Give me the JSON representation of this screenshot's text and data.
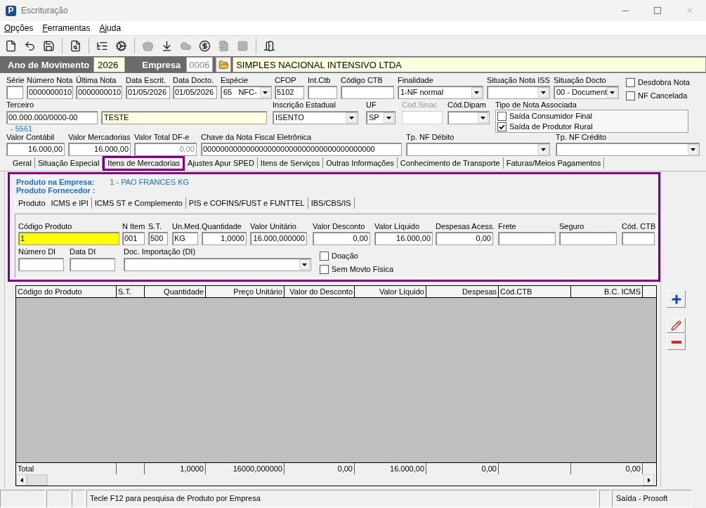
{
  "window": {
    "logo": "P",
    "title": "Escrituração"
  },
  "menu": [
    {
      "label": "Opções"
    },
    {
      "label": "Ferramentas"
    },
    {
      "label": "Ajuda"
    }
  ],
  "toolbar": {
    "groups": [
      [
        {
          "disabled": false
        },
        {
          "disabled": false
        },
        {
          "disabled": false
        }
      ],
      [
        {
          "disabled": false
        }
      ],
      [
        {
          "disabled": false
        },
        {
          "disabled": false
        }
      ],
      [
        {
          "disabled": true
        },
        {
          "disabled": false
        },
        {
          "disabled": true
        },
        {
          "disabled": false
        },
        {
          "disabled": true
        },
        {
          "disabled": true
        }
      ],
      [
        {
          "disabled": false
        }
      ]
    ]
  },
  "header": {
    "year_label": "Ano de Movimento",
    "year": "2026",
    "company_label": "Empresa",
    "company_code": {
      "value": "0006",
      "disabled": true
    },
    "company_name": "SIMPLES NACIONAL INTENSIVO LTDA"
  },
  "note": {
    "row_1": [
      {
        "label": "Série",
        "kind": "input"
      },
      {
        "label": "Número Nota",
        "kind": "input",
        "value": "0000000010"
      },
      {
        "label": "Última Nota",
        "kind": "input",
        "value": "0000000010"
      },
      {
        "label": "Data Escrit.",
        "kind": "input",
        "value": "01/05/2026"
      },
      {
        "label": "Data Docto.",
        "kind": "input",
        "value": "01/05/2026"
      },
      {
        "label": "Espécie",
        "kind": "select",
        "value": "65   NFC-"
      },
      {
        "label": "CFOP",
        "kind": "input",
        "value": "5102"
      },
      {
        "label": "Int.Ctb",
        "kind": "input"
      },
      {
        "label": "Código CTB",
        "kind": "input"
      },
      {
        "label": "Finalidade",
        "kind": "select",
        "value": "1-NF normal"
      },
      {
        "label": "Situação Nota ISS",
        "kind": "select"
      },
      {
        "label": "Situação Docto",
        "kind": "select",
        "value": "00 - Document"
      }
    ],
    "flags": [
      {
        "label": "Desdobra Nota",
        "checked": false
      },
      {
        "label": "NF Cancelada",
        "checked": false
      }
    ],
    "third_party": {
      "label": "Terceiro",
      "document": "00.000.000/0000-00",
      "name": "TESTE",
      "code": "- 5561"
    },
    "row_2": [
      {
        "label": "Inscrição Estadual",
        "kind": "select",
        "value": "ISENTO",
        "disabled": false
      },
      {
        "label": "UF",
        "kind": "select",
        "value": "SP",
        "disabled": false
      },
      {
        "label": "Cod.Sinac",
        "kind": "input",
        "disabled": true
      },
      {
        "label": "Cód.Dipam",
        "kind": "select",
        "disabled": false
      }
    ],
    "associated_type": {
      "label": "Tipo de Nota Associada",
      "options": [
        {
          "label": "Saída Consumidor Final",
          "checked": false
        },
        {
          "label": "Saída de Produtor Rural",
          "checked": true
        }
      ]
    },
    "row_3": [
      {
        "label": "Valor Contábil",
        "kind": "input",
        "value": "16.000,00",
        "readonly": false
      },
      {
        "label": "Valor Mercadorias",
        "kind": "input",
        "value": "16.000,00",
        "readonly": false
      },
      {
        "label": "Valor Total DF-e",
        "kind": "input",
        "value": "0,00",
        "readonly": true
      },
      {
        "label": "Chave da Nota Fiscal Eletrônica",
        "kind": "input",
        "value": "0000000000000000000000000000000000000000",
        "readonly": false
      },
      {
        "label": "Tp. NF Débito",
        "kind": "select",
        "readonly": false
      },
      {
        "label": "Tp. NF Crédito",
        "kind": "select",
        "readonly": false
      }
    ]
  },
  "tabs": [
    {
      "label": "Geral",
      "selected": false
    },
    {
      "label": "Situação Especial",
      "selected": false
    },
    {
      "label": "Itens de Mercadorias",
      "selected": true
    },
    {
      "label": "Ajustes Apur SPED",
      "selected": false
    },
    {
      "label": "Itens de Serviços",
      "selected": false
    },
    {
      "label": "Outras Informações",
      "selected": false
    },
    {
      "label": "Conhecimento de Transporte",
      "selected": false
    },
    {
      "label": "Faturas/Meios Pagamentos",
      "selected": false
    }
  ],
  "item_panel": {
    "product_company": {
      "label": "Produto na Empresa:",
      "value": "1 - PAO FRANCES KG"
    },
    "product_supplier": {
      "label": "Produto Fornecedor :"
    },
    "tabs": [
      {
        "label": "Produto",
        "selected": true
      },
      {
        "label": "ICMS e IPI",
        "selected": false
      },
      {
        "label": "ICMS ST e Complemento",
        "selected": false
      },
      {
        "label": "PIS e COFINS/FUST e FUNTTEL",
        "selected": false
      },
      {
        "label": "IBS/CBS/IS",
        "selected": false
      }
    ],
    "fields": [
      {
        "label": "Código Produto",
        "kind": "input",
        "value": "1",
        "focused": true
      },
      {
        "label": "N Item",
        "kind": "input",
        "value": "001",
        "focused": false
      },
      {
        "label": "S.T.",
        "kind": "input",
        "value": "500",
        "focused": false
      },
      {
        "label": "Un.Med.",
        "kind": "input",
        "value": "KG",
        "focused": false
      },
      {
        "label": "Quantidade",
        "kind": "input",
        "value": "1,0000",
        "focused": false
      },
      {
        "label": "Valor Unitário",
        "kind": "input",
        "value": "16.000,000000",
        "focused": false
      },
      {
        "label": "Valor Desconto",
        "kind": "input",
        "value": "0,00",
        "focused": false
      },
      {
        "label": "Valor Líquido",
        "kind": "input",
        "value": "16.000,00",
        "focused": false
      },
      {
        "label": "Despesas Acess.",
        "kind": "input",
        "value": "0,00",
        "focused": false
      },
      {
        "label": "Frete",
        "kind": "input",
        "focused": false
      },
      {
        "label": "Seguro",
        "kind": "input",
        "focused": false
      },
      {
        "label": "Cód. CTB",
        "kind": "input",
        "focused": false
      }
    ],
    "import_fields": [
      {
        "label": "Número DI",
        "kind": "input"
      },
      {
        "label": "Data DI",
        "kind": "input"
      },
      {
        "label": "Doc. Importação (DI)",
        "kind": "select"
      }
    ],
    "flags": [
      {
        "label": "Doação",
        "checked": false
      },
      {
        "label": "Sem Movto Física",
        "checked": false
      }
    ]
  },
  "items_grid": {
    "columns": [
      {
        "title": "Código do Produto",
        "total": "Total"
      },
      {
        "title": "S.T."
      },
      {
        "title": "Quantidade",
        "total": "1,0000"
      },
      {
        "title": "Preço Unitário",
        "total": "16000,000000"
      },
      {
        "title": "Valor do Desconto",
        "total": "0,00"
      },
      {
        "title": "Valor Líquido",
        "total": "16.000,00"
      },
      {
        "title": "Despesas",
        "total": "0,00"
      },
      {
        "title": "Cód.CTB"
      },
      {
        "title": "B.C. ICMS",
        "total": "0,00"
      }
    ]
  },
  "status_bar": {
    "hint": "Tecle F12 para pesquisa de Produto por Empresa",
    "mode": "Saída - Prosoft"
  }
}
